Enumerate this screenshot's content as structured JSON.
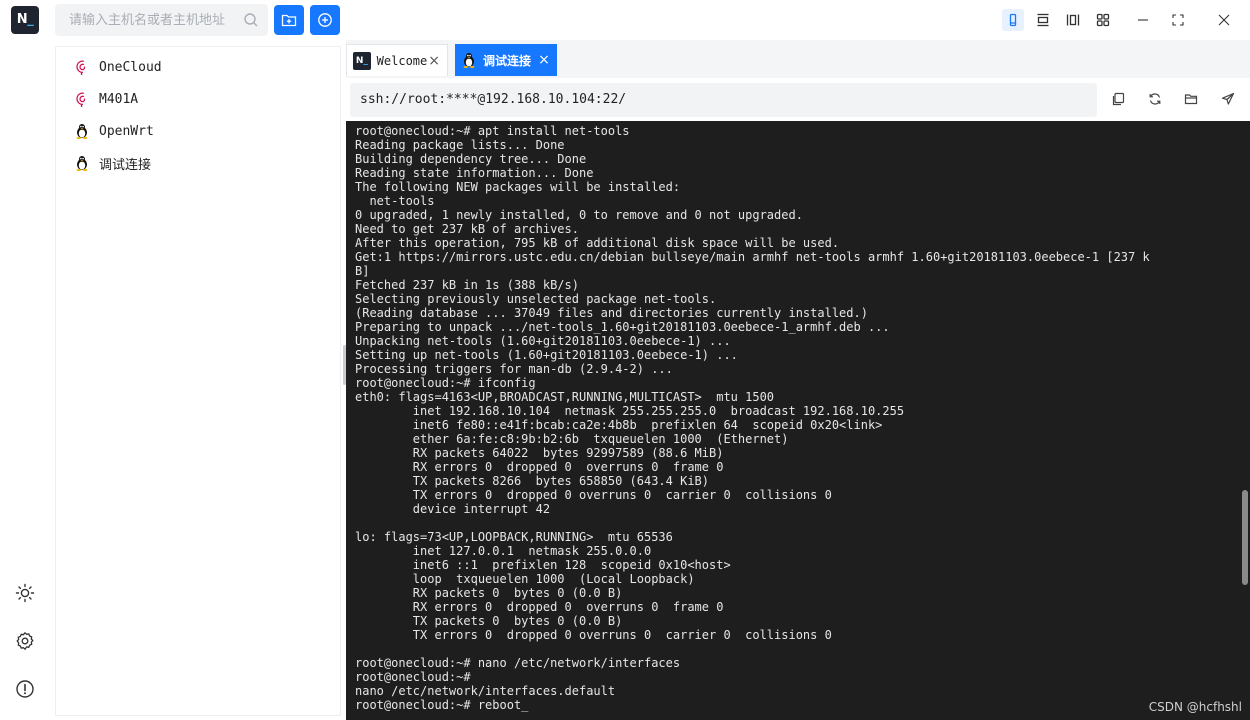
{
  "header": {
    "logo_text_n": "N",
    "logo_text_u": "_",
    "search_placeholder": "请输入主机名或者主机地址"
  },
  "colors": {
    "accent": "#1677ff",
    "terminal_bg": "#1e1e1e",
    "terminal_fg": "#e6e6e6"
  },
  "hosts": [
    {
      "label": "OneCloud",
      "icon": "debian-icon"
    },
    {
      "label": "M401A",
      "icon": "debian-icon"
    },
    {
      "label": "OpenWrt",
      "icon": "linux-tux-icon"
    },
    {
      "label": "调试连接",
      "icon": "linux-tux-icon"
    }
  ],
  "tabs": [
    {
      "label": "Welcome",
      "icon": "app-logo-icon"
    },
    {
      "label": "调试连接",
      "icon": "linux-tux-icon"
    }
  ],
  "address": "ssh://root:****@192.168.10.104:22/",
  "terminal_lines": [
    "root@onecloud:~# apt install net-tools",
    "Reading package lists... Done",
    "Building dependency tree... Done",
    "Reading state information... Done",
    "The following NEW packages will be installed:",
    "  net-tools",
    "0 upgraded, 1 newly installed, 0 to remove and 0 not upgraded.",
    "Need to get 237 kB of archives.",
    "After this operation, 795 kB of additional disk space will be used.",
    "Get:1 https://mirrors.ustc.edu.cn/debian bullseye/main armhf net-tools armhf 1.60+git20181103.0eebece-1 [237 k",
    "B]",
    "Fetched 237 kB in 1s (388 kB/s)",
    "Selecting previously unselected package net-tools.",
    "(Reading database ... 37049 files and directories currently installed.)",
    "Preparing to unpack .../net-tools_1.60+git20181103.0eebece-1_armhf.deb ...",
    "Unpacking net-tools (1.60+git20181103.0eebece-1) ...",
    "Setting up net-tools (1.60+git20181103.0eebece-1) ...",
    "Processing triggers for man-db (2.9.4-2) ...",
    "root@onecloud:~# ifconfig",
    "eth0: flags=4163<UP,BROADCAST,RUNNING,MULTICAST>  mtu 1500",
    "        inet 192.168.10.104  netmask 255.255.255.0  broadcast 192.168.10.255",
    "        inet6 fe80::e41f:bcab:ca2e:4b8b  prefixlen 64  scopeid 0x20<link>",
    "        ether 6a:fe:c8:9b:b2:6b  txqueuelen 1000  (Ethernet)",
    "        RX packets 64022  bytes 92997589 (88.6 MiB)",
    "        RX errors 0  dropped 0  overruns 0  frame 0",
    "        TX packets 8266  bytes 658850 (643.4 KiB)",
    "        TX errors 0  dropped 0 overruns 0  carrier 0  collisions 0",
    "        device interrupt 42",
    "",
    "lo: flags=73<UP,LOOPBACK,RUNNING>  mtu 65536",
    "        inet 127.0.0.1  netmask 255.0.0.0",
    "        inet6 ::1  prefixlen 128  scopeid 0x10<host>",
    "        loop  txqueuelen 1000  (Local Loopback)",
    "        RX packets 0  bytes 0 (0.0 B)",
    "        RX errors 0  dropped 0  overruns 0  frame 0",
    "        TX packets 0  bytes 0 (0.0 B)",
    "        TX errors 0  dropped 0 overruns 0  carrier 0  collisions 0",
    "",
    "root@onecloud:~# nano /etc/network/interfaces",
    "root@onecloud:~#",
    "nano /etc/network/interfaces.default",
    "root@onecloud:~# reboot_"
  ],
  "watermark": "CSDN @hcfhshl"
}
